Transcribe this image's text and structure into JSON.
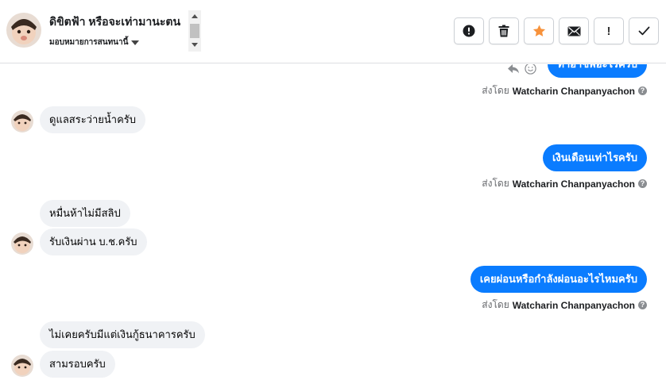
{
  "header": {
    "contact_name": "ดิขิตฟ้า หรือจะเท่ามานะตน",
    "assign_label": "มอบหมายการสนทนานี้"
  },
  "actions": [
    {
      "name": "mark-spam",
      "label": "!"
    },
    {
      "name": "delete",
      "label": "delete"
    },
    {
      "name": "star",
      "label": "star"
    },
    {
      "name": "mark-unread",
      "label": "mail"
    },
    {
      "name": "mark-important",
      "label": "!"
    },
    {
      "name": "mark-done",
      "label": "done"
    }
  ],
  "messages": [
    {
      "direction": "out",
      "text": "ทำอาชีพอะไรครับ",
      "sent_by_prefix": "ส่งโดย",
      "sender": "Watcharin Chanpanyachon"
    },
    {
      "direction": "in",
      "text": "ดูแลสระว่ายน้ำครับ"
    },
    {
      "direction": "out",
      "text": "เงินเดือนเท่าไรครับ",
      "sent_by_prefix": "ส่งโดย",
      "sender": "Watcharin Chanpanyachon"
    },
    {
      "direction": "in",
      "text": "หมื่นห้าไม่มีสลิป"
    },
    {
      "direction": "in",
      "text": "รับเงินผ่าน บ.ช.ครับ"
    },
    {
      "direction": "out",
      "text": "เคยผ่อนหรือกำลังผ่อนอะไรไหมครับ",
      "sent_by_prefix": "ส่งโดย",
      "sender": "Watcharin Chanpanyachon"
    },
    {
      "direction": "in",
      "text": "ไม่เคยครับมีแต่เงินกู้ธนาคารครับ"
    },
    {
      "direction": "in",
      "text": "สามรอบครับ"
    }
  ],
  "colors": {
    "outgoing_bubble": "#0a7cff",
    "incoming_bubble": "#f0f2f5",
    "star": "#f7923b"
  }
}
